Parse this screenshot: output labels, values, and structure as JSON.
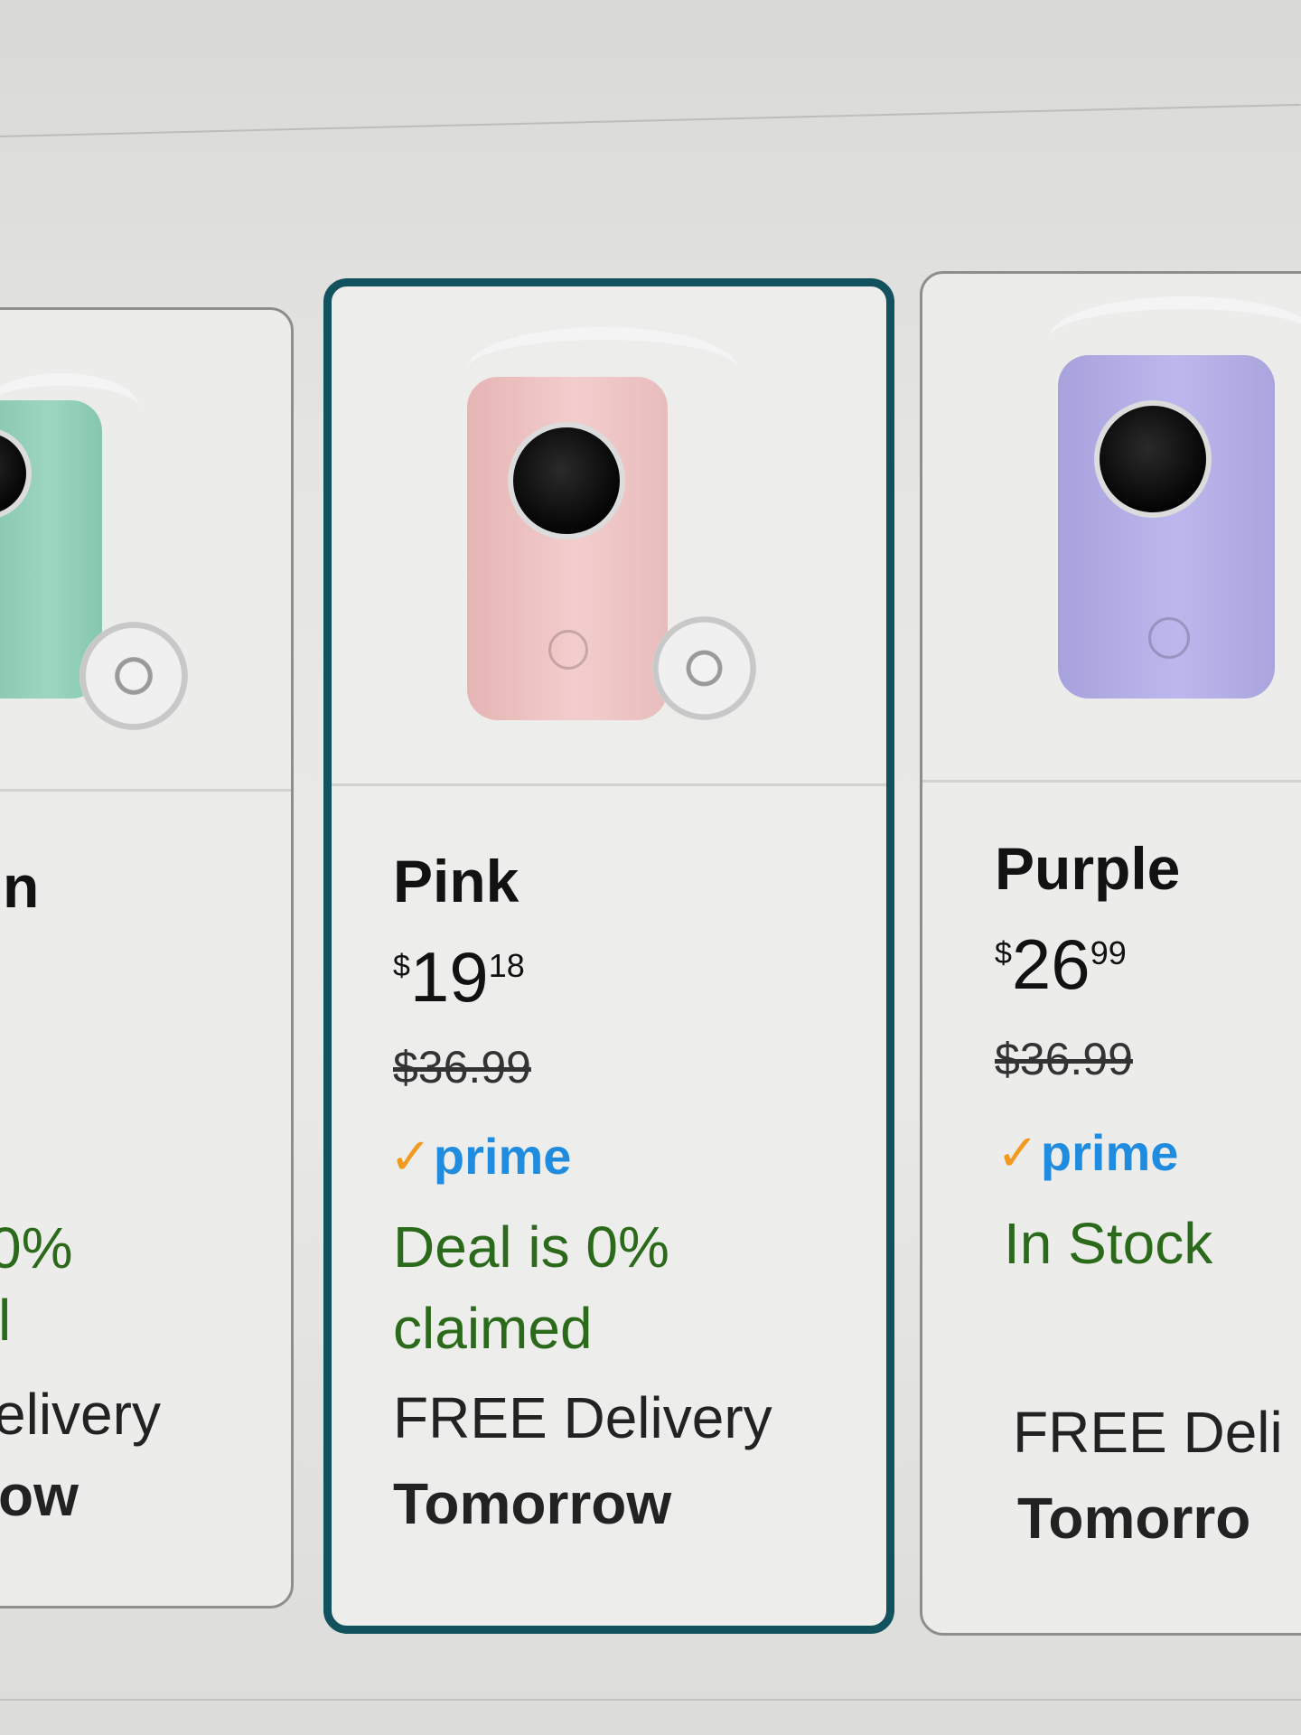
{
  "cards": {
    "left": {
      "title": "n",
      "deal_status": "0%",
      "claimed_line": "l",
      "delivery_label": "elivery",
      "delivery_day": "ow"
    },
    "middle": {
      "title": "Pink",
      "price": {
        "symbol": "$",
        "whole": "19",
        "fraction": "18"
      },
      "list_price": "$36.99",
      "prime_label": "prime",
      "deal_status_line1": "Deal is 0%",
      "deal_status_line2": "claimed",
      "delivery_label": "FREE Delivery",
      "delivery_day": "Tomorrow",
      "selected": true,
      "accent_color": "#11525e"
    },
    "right": {
      "title": "Purple",
      "price": {
        "symbol": "$",
        "whole": "26",
        "fraction": "99"
      },
      "list_price": "$36.99",
      "prime_label": "prime",
      "stock_status": "In Stock",
      "delivery_label": "FREE Deli",
      "delivery_day": "Tomorro"
    }
  },
  "colors": {
    "prime_blue": "#1f8ce0",
    "prime_check": "#f29a1f",
    "deal_green": "#2a6a1a",
    "mint_printer": "#8fcdb5",
    "pink_printer": "#f0c5c5",
    "purple_printer": "#b3aee3"
  }
}
